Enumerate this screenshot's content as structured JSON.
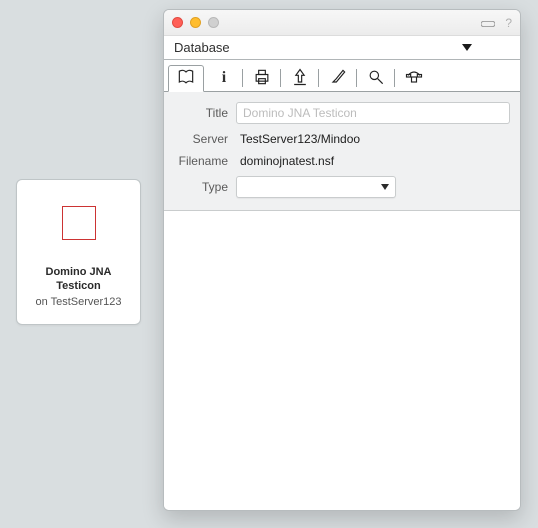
{
  "tile": {
    "title_line1": "Domino JNA",
    "title_line2": "Testicon",
    "subtitle": "on TestServer123"
  },
  "window": {
    "category_label": "Database",
    "tabs": [
      {
        "name": "book-icon"
      },
      {
        "name": "info-icon"
      },
      {
        "name": "printer-icon"
      },
      {
        "name": "launch-icon"
      },
      {
        "name": "brush-icon"
      },
      {
        "name": "search-icon"
      },
      {
        "name": "phone-icon"
      }
    ],
    "form": {
      "labels": {
        "title": "Title",
        "server": "Server",
        "filename": "Filename",
        "type": "Type"
      },
      "values": {
        "title_placeholder": "Domino JNA Testicon",
        "title_value": "",
        "server": "TestServer123/Mindoo",
        "filename": "dominojnatest.nsf",
        "type": ""
      }
    }
  }
}
